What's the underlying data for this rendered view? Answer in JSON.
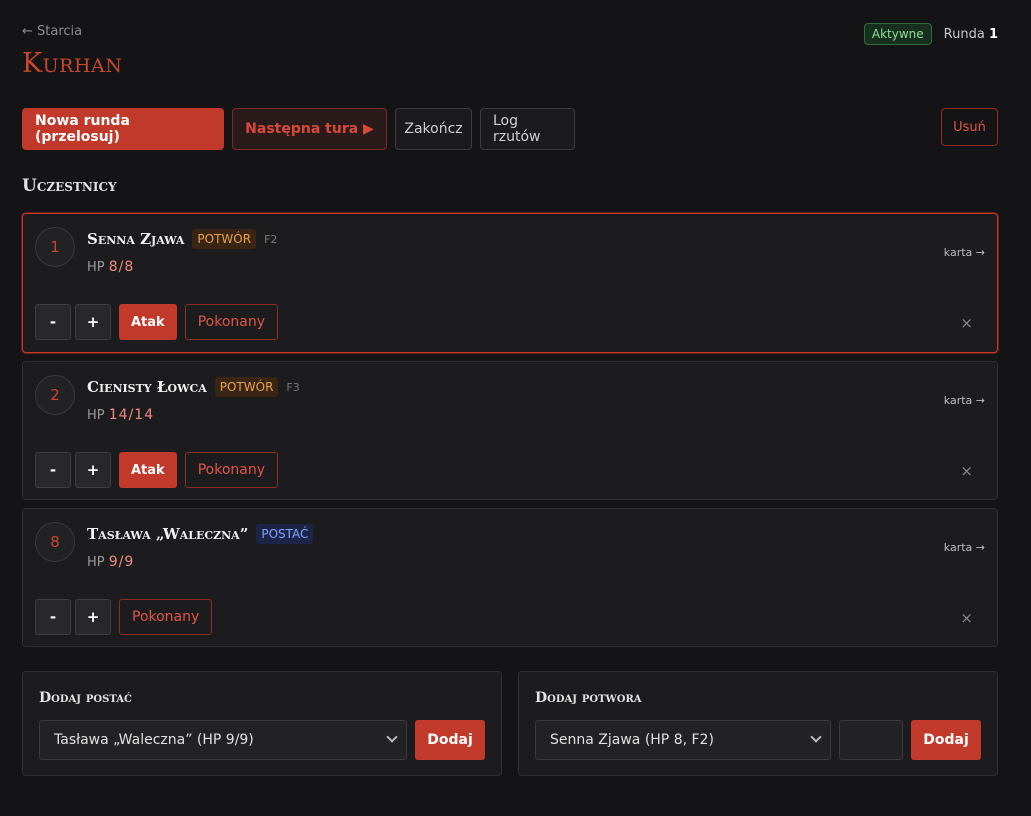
{
  "header": {
    "back_label": "← Starcia",
    "title": "Kurhan",
    "status_badge": "Aktywne",
    "round_label": "Runda",
    "round_number": "1"
  },
  "toolbar": {
    "new_round": "Nowa runda (przelosuj)",
    "next_turn": "Następna tura ▶",
    "finish": "Zakończ",
    "roll_log": "Log rzutów",
    "delete": "Usuń"
  },
  "participants_title": "Uczestnicy",
  "participants": [
    {
      "initiative": "1",
      "name": "Senna Zjawa",
      "tag": "POTWÓR",
      "code": "F2",
      "hp_label": "HP",
      "hp": "8/8",
      "card": "karta →",
      "minus": "-",
      "plus": "+",
      "attack": "Atak",
      "defeated": "Pokonany",
      "remove": "×"
    },
    {
      "initiative": "2",
      "name": "Cienisty Łowca",
      "tag": "POTWÓR",
      "code": "F3",
      "hp_label": "HP",
      "hp": "14/14",
      "card": "karta →",
      "minus": "-",
      "plus": "+",
      "attack": "Atak",
      "defeated": "Pokonany",
      "remove": "×"
    },
    {
      "initiative": "8",
      "name": "Tasława „Waleczna”",
      "tag": "POSTAĆ",
      "hp_label": "HP",
      "hp": "9/9",
      "card": "karta →",
      "minus": "-",
      "plus": "+",
      "defeated": "Pokonany",
      "remove": "×"
    }
  ],
  "add_character": {
    "title": "Dodaj postać",
    "selected": "Tasława „Waleczna” (HP 9/9)",
    "button": "Dodaj"
  },
  "add_monster": {
    "title": "Dodaj potwora",
    "selected": "Senna Zjawa (HP 8, F2)",
    "button": "Dodaj"
  },
  "colors": {
    "accent": "#c0392b",
    "background": "#141416",
    "card": "#1c1c1e",
    "monster_tag": "#e8a34e",
    "character_tag": "#7fa3ff",
    "active_badge": "#8fdc9a"
  }
}
